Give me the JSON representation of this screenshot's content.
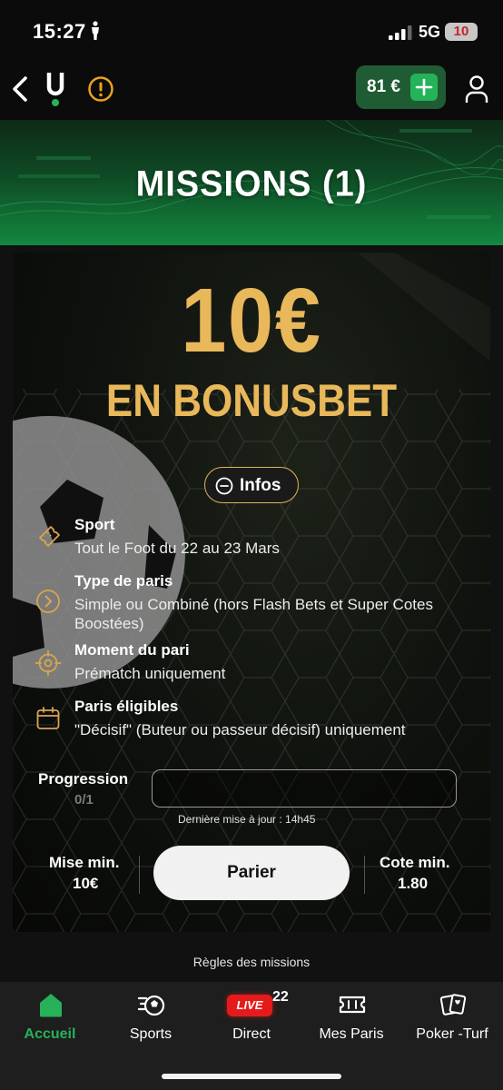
{
  "status_bar": {
    "time": "15:27",
    "network": "5G",
    "battery": "10"
  },
  "header": {
    "balance": "81 €"
  },
  "banner": {
    "title": "MISSIONS (1)"
  },
  "mission": {
    "amount": "10€",
    "bonus_label": "EN BONUSBET",
    "infos_label": "Infos",
    "details": [
      {
        "title": "Sport",
        "value": "Tout le Foot du 22 au 23 Mars",
        "icon": "ticket-icon"
      },
      {
        "title": "Type de paris",
        "value": "Simple ou Combiné (hors Flash Bets et Super Cotes Boostées)",
        "icon": "chevron-circle-icon"
      },
      {
        "title": "Moment du pari",
        "value": "Prématch uniquement",
        "icon": "target-icon"
      },
      {
        "title": "Paris éligibles",
        "value": "\"Décisif\" (Buteur ou passeur décisif) uniquement",
        "icon": "calendar-icon"
      }
    ],
    "progress": {
      "label": "Progression",
      "count": "0/1",
      "fraction": 0,
      "updated": "Dernière mise à jour : 14h45"
    },
    "min_stake": {
      "label": "Mise min.",
      "value": "10€"
    },
    "bet_button": "Parier",
    "min_odds": {
      "label": "Cote min.",
      "value": "1.80"
    }
  },
  "rules_link": "Règles des missions",
  "nav": {
    "items": [
      {
        "label": "Accueil",
        "icon": "home-icon",
        "active": true
      },
      {
        "label": "Sports",
        "icon": "football-icon"
      },
      {
        "label": "Direct",
        "icon": "live-icon",
        "badge": "LIVE",
        "count": "22"
      },
      {
        "label": "Mes Paris",
        "icon": "bet-ticket-icon"
      },
      {
        "label": "Poker -Turf",
        "icon": "cards-icon"
      }
    ]
  },
  "colors": {
    "accent_green": "#27b158",
    "gold": "#e9b85a",
    "live_red": "#e51b1b",
    "background": "#111111"
  }
}
